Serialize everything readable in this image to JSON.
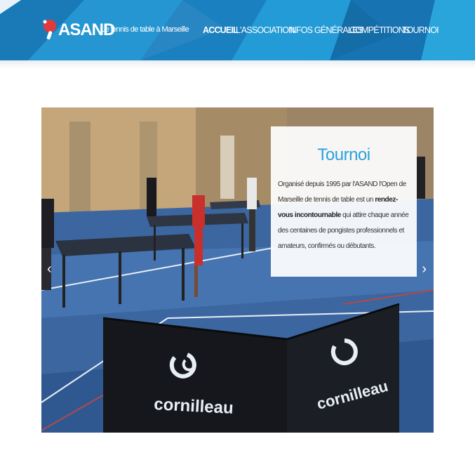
{
  "header": {
    "logo_text": "ASAND",
    "tagline": "Le tennis de table à Marseille"
  },
  "nav": {
    "items": [
      {
        "label": "ACCUEIL",
        "active": true
      },
      {
        "label": "L'ASSOCIATION",
        "active": false
      },
      {
        "label": "INFOS GÉNÉRALES",
        "active": false
      },
      {
        "label": "COMPÉTITIONS",
        "active": false
      },
      {
        "label": "TOURNOI",
        "active": false
      }
    ]
  },
  "slider": {
    "slide_title": "Tournoi",
    "text_1": "Organisé depuis 1995 par l'ASAND l'Open de Marseille de tennis de table est un ",
    "text_bold": "rendez-vous incontournable",
    "text_2": " qui attire chaque année des centaines de pongistes professionnels et amateurs, confirmés ou débutants.",
    "prev_icon": "chevron-left-icon",
    "next_icon": "chevron-right-icon",
    "barrier_brand": "cornilleau"
  },
  "colors": {
    "header_blue": "#1b86c4",
    "accent": "#2aa2dc",
    "logo_red": "#e23a3a"
  }
}
